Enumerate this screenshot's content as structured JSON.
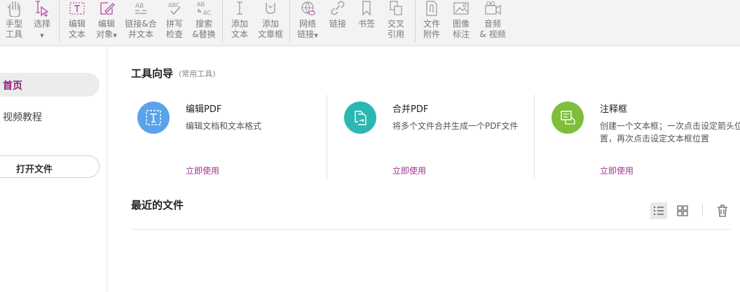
{
  "toolbar": {
    "hand": {
      "label": "手型\n工具"
    },
    "select": {
      "label": "选择"
    },
    "edit_text": {
      "label": "编辑\n文本"
    },
    "edit_object": {
      "label": "编辑\n对象"
    },
    "link_merge": {
      "label": "链接&合\n并文本"
    },
    "spell_check": {
      "label": "拼写\n检查"
    },
    "search_replace": {
      "label": "搜索\n&替换"
    },
    "add_text": {
      "label": "添加\n文本"
    },
    "add_textbox": {
      "label": "添加\n文章框"
    },
    "web_link": {
      "label": "网络\n链接"
    },
    "link": {
      "label": "链接"
    },
    "bookmark": {
      "label": "书签"
    },
    "cross_ref": {
      "label": "交叉\n引用"
    },
    "file_attach": {
      "label": "文件\n附件"
    },
    "image_annot": {
      "label": "图像\n标注"
    },
    "audio_video": {
      "label": "音频\n& 视频"
    }
  },
  "sidebar": {
    "home": "首页",
    "video_tutorial": "视频教程",
    "open_file": "打开文件"
  },
  "tool_guide": {
    "title": "工具向导",
    "subtitle": "(常用工具)"
  },
  "cards": [
    {
      "title": "编辑PDF",
      "desc": "编辑文档和文本格式",
      "action": "立即使用",
      "color": "#5aa3ec"
    },
    {
      "title": "合并PDF",
      "desc": "将多个文件合并生成一个PDF文件",
      "action": "立即使用",
      "color": "#2bb7b4"
    },
    {
      "title": "注释框",
      "desc": "创建一个文本框；一次点击设定箭头位置，再次点击设定文本框位置",
      "action": "立即使用",
      "color": "#7fbe3c"
    }
  ],
  "recent": {
    "title": "最近的文件"
  }
}
